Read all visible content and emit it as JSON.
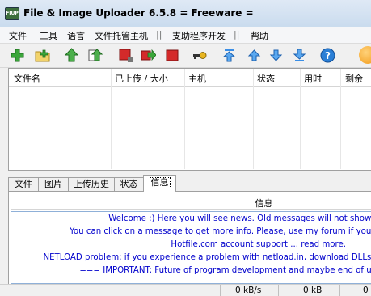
{
  "window": {
    "icon_text": "FIUP",
    "title": "File & Image Uploader 6.5.8  = Freeware ="
  },
  "menu": {
    "items": [
      "文件",
      "工具",
      "语言",
      "文件托管主机",
      "支助程序开发",
      "帮助"
    ],
    "separators": [
      "||",
      "||"
    ]
  },
  "toolbar": {
    "icons": [
      "add-icon",
      "add-folder-icon",
      "upload-icon",
      "upload-all-icon",
      "stop-icon",
      "retry-icon",
      "stop-all-icon",
      "key-icon",
      "move-top-icon",
      "move-up-icon",
      "move-down-icon",
      "move-bottom-icon",
      "help-icon",
      "orange-ball-icon"
    ]
  },
  "upload_list": {
    "columns": [
      "文件名",
      "已上传 / 大小",
      "主机",
      "状态",
      "用时",
      "剩余"
    ]
  },
  "tabs": {
    "items": [
      "文件",
      "图片",
      "上传历史",
      "状态",
      "信息"
    ],
    "active": "信息"
  },
  "info_panel": {
    "header": "信息",
    "news": [
      "Welcome :) Here you will see news. Old messages will not show u",
      "You can click on a message to get more info. Please, use my forum if you n",
      "Hotfile.com account support ... read more.",
      "NETLOAD problem: if you experience a problem with netload.in, download DLLs fi",
      "=== IMPORTANT: Future of program development and maybe end of upl"
    ]
  },
  "statusbar": {
    "speed": "0 kB/s",
    "size": "0 kB",
    "extra": "0"
  },
  "colors": {
    "news_text": "#0000cc",
    "title_bar": "#c9dbee"
  }
}
